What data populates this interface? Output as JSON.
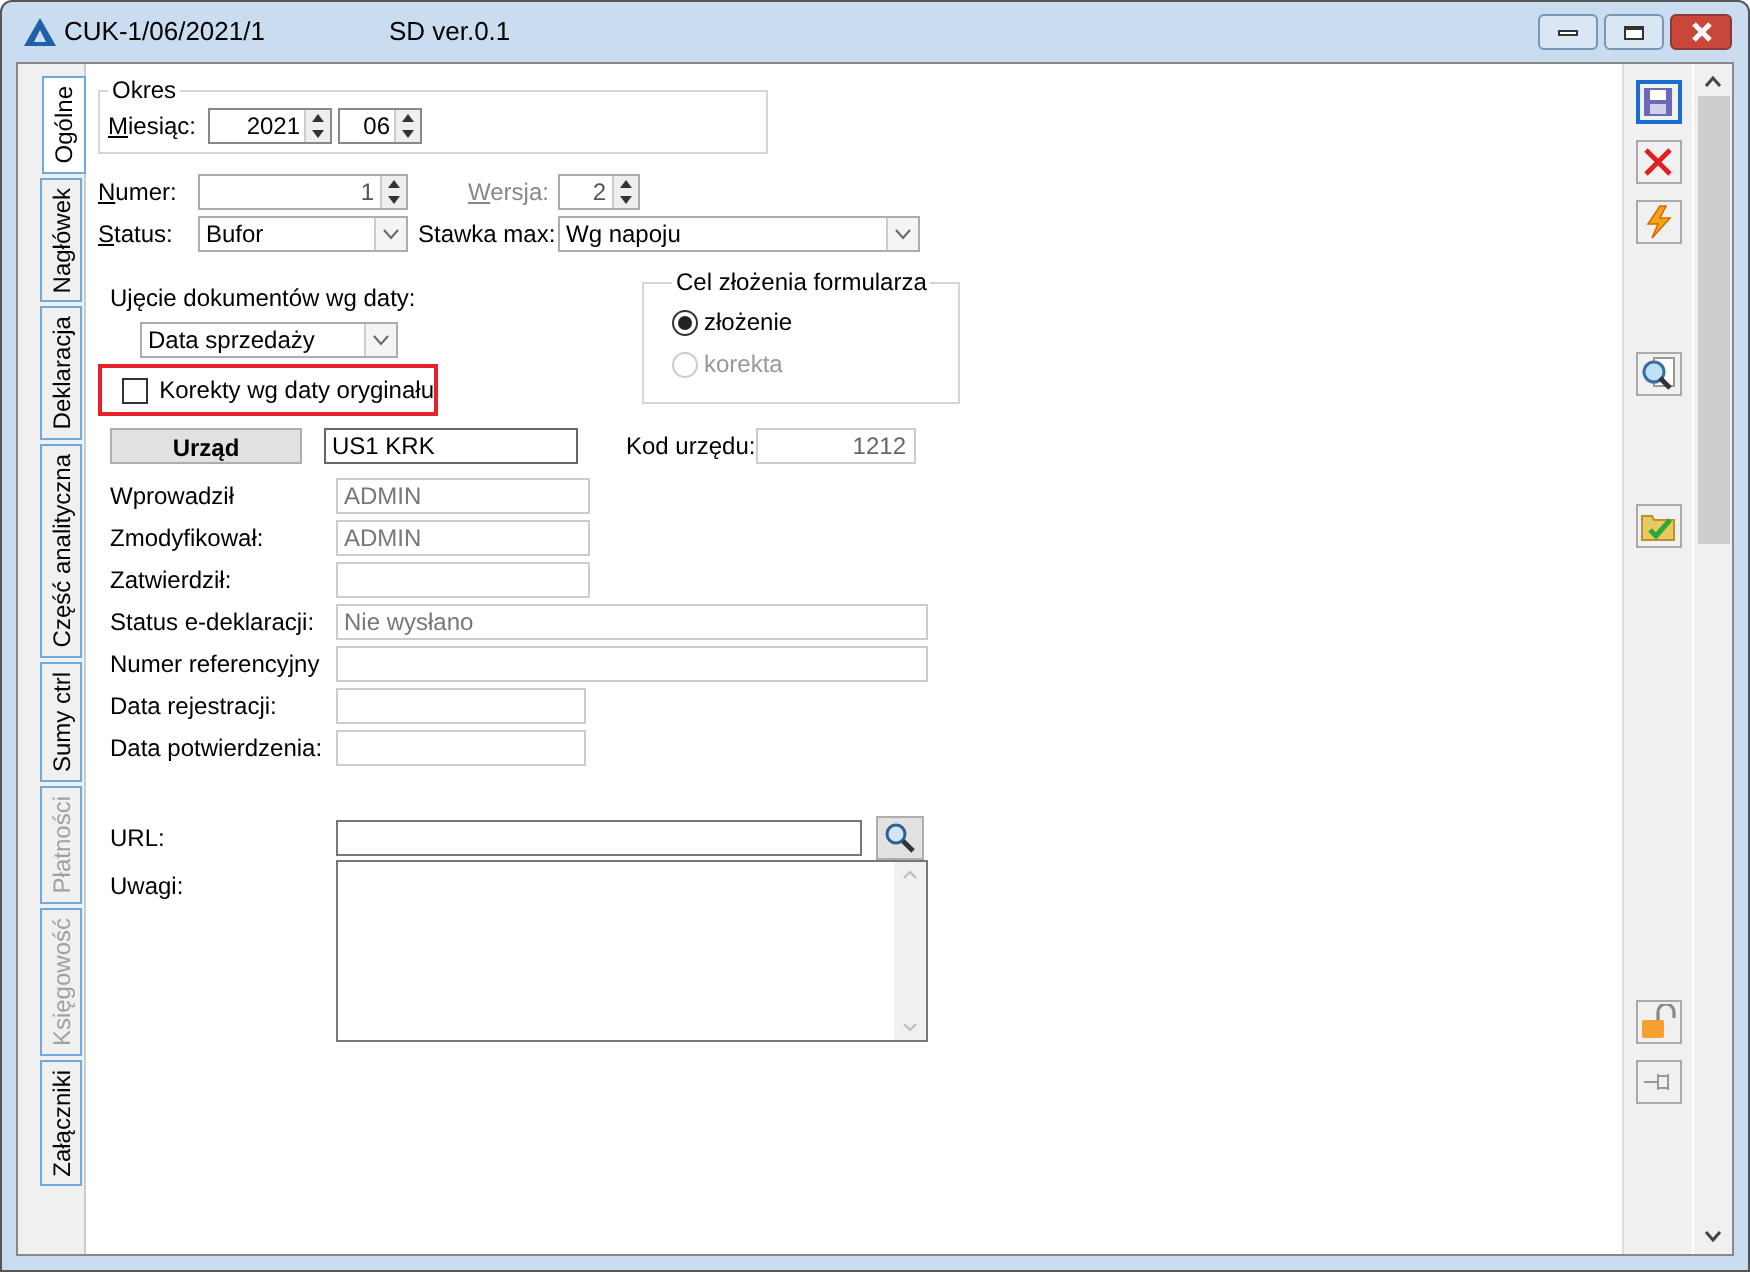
{
  "window": {
    "title": "CUK-1/06/2021/1",
    "subtitle": "SD ver.0.1"
  },
  "side_tabs": [
    {
      "label": "Ogólne",
      "selected": true,
      "disabled": false
    },
    {
      "label": "Nagłówek",
      "selected": false,
      "disabled": false
    },
    {
      "label": "Deklaracja",
      "selected": false,
      "disabled": false
    },
    {
      "label": "Część analityczna",
      "selected": false,
      "disabled": false
    },
    {
      "label": "Sumy ctrl",
      "selected": false,
      "disabled": false
    },
    {
      "label": "Płatności",
      "selected": false,
      "disabled": true
    },
    {
      "label": "Księgowość",
      "selected": false,
      "disabled": true
    },
    {
      "label": "Załączniki",
      "selected": false,
      "disabled": false
    }
  ],
  "okres": {
    "title": "Okres",
    "label": "Miesiąc:",
    "year": "2021",
    "month": "06"
  },
  "numer": {
    "label": "Numer:",
    "value": "1"
  },
  "wersja": {
    "label": "Wersja:",
    "value": "2",
    "disabled": true
  },
  "status": {
    "label": "Status:",
    "value": "Bufor"
  },
  "stawka": {
    "label": "Stawka max:",
    "value": "Wg napoju"
  },
  "ujecie": {
    "label": "Ujęcie dokumentów wg daty:",
    "value": "Data sprzedaży"
  },
  "korekty": {
    "label": "Korekty wg daty oryginału",
    "checked": false,
    "highlighted": true
  },
  "cel": {
    "title": "Cel złożenia formularza",
    "options": [
      {
        "label": "złożenie",
        "selected": true,
        "disabled": false
      },
      {
        "label": "korekta",
        "selected": false,
        "disabled": true
      }
    ]
  },
  "urzad": {
    "button": "Urząd",
    "value": "US1 KRK"
  },
  "kod": {
    "label": "Kod urzędu:",
    "value": "1212"
  },
  "info_fields": [
    {
      "label": "Wprowadził",
      "value": "ADMIN",
      "kind": "short"
    },
    {
      "label": "Zmodyfikował:",
      "value": "ADMIN",
      "kind": "short"
    },
    {
      "label": "Zatwierdził:",
      "kind": "short"
    },
    {
      "label": "Status e-deklaracji:",
      "value": "Nie wysłano",
      "kind": "wide"
    },
    {
      "label": "Numer referencyjny",
      "kind": "wide"
    },
    {
      "label": "Data rejestracji:",
      "kind": "date"
    },
    {
      "label": "Data potwierdzenia:",
      "kind": "date"
    }
  ],
  "url": {
    "label": "URL:"
  },
  "uwagi": {
    "label": "Uwagi:"
  },
  "toolbar": [
    {
      "kind": "save",
      "focused": true
    },
    {
      "kind": "cancel",
      "focused": false
    },
    {
      "kind": "lightning",
      "focused": false
    },
    {
      "kind": "gap"
    },
    {
      "kind": "preview",
      "focused": false
    },
    {
      "kind": "gap"
    },
    {
      "kind": "folder-check",
      "focused": false
    },
    {
      "kind": "bottom"
    },
    {
      "kind": "lock",
      "focused": false
    },
    {
      "kind": "pin",
      "focused": false
    }
  ]
}
